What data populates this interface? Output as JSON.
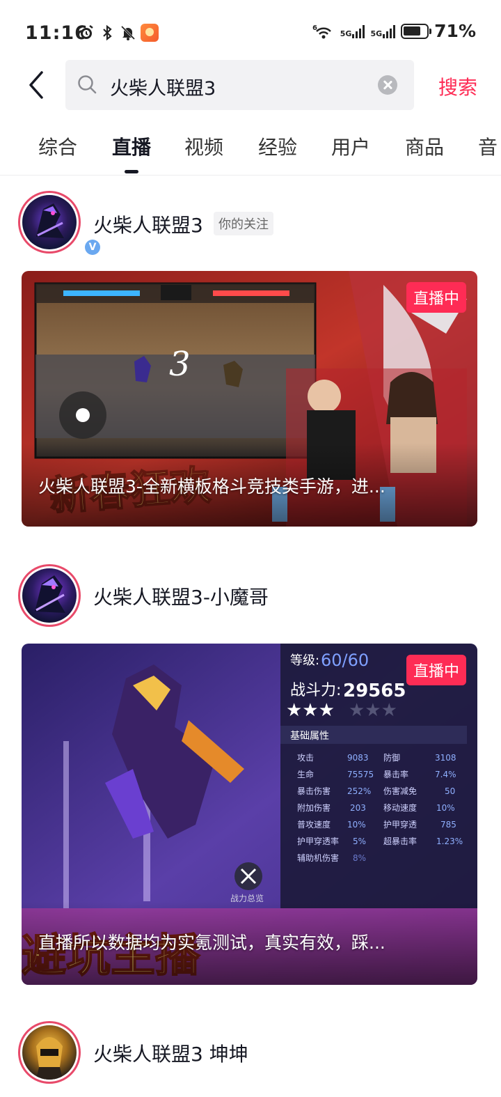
{
  "status_bar": {
    "time": "11:16",
    "battery_percent": "71%",
    "network_left": "5G",
    "network_right": "5G",
    "wifi_label": "6"
  },
  "search": {
    "query": "火柴人联盟3",
    "submit_label": "搜索"
  },
  "tabs": [
    {
      "label": "综合",
      "active": false
    },
    {
      "label": "直播",
      "active": true
    },
    {
      "label": "视频",
      "active": false
    },
    {
      "label": "经验",
      "active": false
    },
    {
      "label": "用户",
      "active": false
    },
    {
      "label": "商品",
      "active": false
    },
    {
      "label": "音",
      "active": false
    }
  ],
  "results": [
    {
      "anchor_name": "火柴人联盟3",
      "follow_tag": "你的关注",
      "live_badge": "直播中",
      "caption": "火柴人联盟3-全新横板格斗竞技类手游，进..."
    },
    {
      "anchor_name": "火柴人联盟3-小魔哥",
      "live_badge": "直播中",
      "caption": "直播所以数据均为实氪测试，真实有效，踩..."
    },
    {
      "anchor_name": "火柴人联盟3  坤坤"
    }
  ],
  "colors": {
    "accent": "#fe2c55",
    "avatar_ring": "#e84a6a",
    "text_primary": "#161823"
  }
}
